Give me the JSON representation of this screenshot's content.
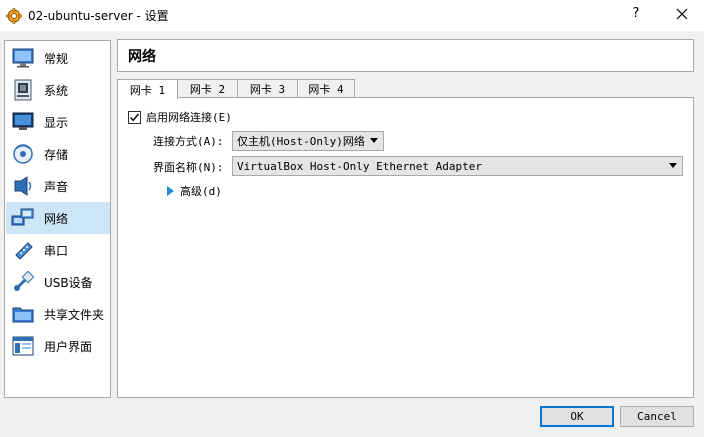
{
  "window": {
    "title": "02-ubuntu-server - 设置",
    "help_label": "?"
  },
  "sidebar": {
    "items": [
      {
        "label": "常规",
        "icon": "general-icon"
      },
      {
        "label": "系统",
        "icon": "system-icon"
      },
      {
        "label": "显示",
        "icon": "display-icon"
      },
      {
        "label": "存储",
        "icon": "storage-icon"
      },
      {
        "label": "声音",
        "icon": "audio-icon"
      },
      {
        "label": "网络",
        "icon": "network-icon",
        "selected": true
      },
      {
        "label": "串口",
        "icon": "serial-port-icon"
      },
      {
        "label": "USB设备",
        "icon": "usb-icon"
      },
      {
        "label": "共享文件夹",
        "icon": "shared-folder-icon"
      },
      {
        "label": "用户界面",
        "icon": "user-interface-icon"
      }
    ]
  },
  "section": {
    "title": "网络"
  },
  "tabs": [
    {
      "label": "网卡 1",
      "active": true
    },
    {
      "label": "网卡 2"
    },
    {
      "label": "网卡 3"
    },
    {
      "label": "网卡 4"
    }
  ],
  "adapter": {
    "enable_label": "启用网络连接(E)",
    "enable_checked": true,
    "attached_label": "连接方式(A):",
    "attached_value": "仅主机(Host-Only)网络",
    "name_label": "界面名称(N):",
    "name_value": "VirtualBox Host-Only Ethernet Adapter",
    "advanced_label": "高级(d)"
  },
  "buttons": {
    "ok": "OK",
    "cancel": "Cancel"
  },
  "colors": {
    "selection": "#cde6f7",
    "accent": "#0078d7",
    "expander": "#1e8fd8"
  }
}
